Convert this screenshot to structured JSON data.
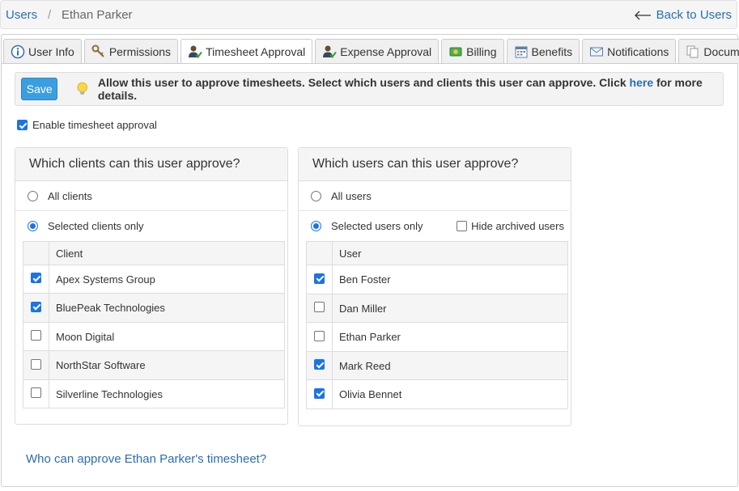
{
  "breadcrumb": {
    "root": "Users",
    "separator": "/",
    "current": "Ethan Parker",
    "back_label": "Back to Users"
  },
  "tabs": [
    {
      "label": "User Info",
      "icon": "info-icon",
      "active": false
    },
    {
      "label": "Permissions",
      "icon": "keys-icon",
      "active": false
    },
    {
      "label": "Timesheet Approval",
      "icon": "user-check-icon",
      "active": true
    },
    {
      "label": "Expense Approval",
      "icon": "user-check-icon",
      "active": false
    },
    {
      "label": "Billing",
      "icon": "money-icon",
      "active": false
    },
    {
      "label": "Benefits",
      "icon": "calendar-icon",
      "active": false
    },
    {
      "label": "Notifications",
      "icon": "envelope-icon",
      "active": false
    },
    {
      "label": "Documents",
      "icon": "documents-icon",
      "active": false
    }
  ],
  "notice": {
    "save_label": "Save",
    "text_before": "Allow this user to approve timesheets. Select which users and clients this user can approve. Click ",
    "link": "here",
    "text_after": " for more details."
  },
  "enable": {
    "label": "Enable timesheet approval",
    "checked": true
  },
  "clients_box": {
    "title": "Which clients can this user approve?",
    "opt_all": "All clients",
    "opt_selected": "Selected clients only",
    "selected_option": "selected",
    "column": "Client",
    "rows": [
      {
        "name": "Apex Systems Group",
        "checked": true
      },
      {
        "name": "BluePeak Technologies",
        "checked": true
      },
      {
        "name": "Moon Digital",
        "checked": false
      },
      {
        "name": "NorthStar Software",
        "checked": false
      },
      {
        "name": "Silverline Technologies",
        "checked": false
      }
    ]
  },
  "users_box": {
    "title": "Which users can this user approve?",
    "opt_all": "All users",
    "opt_selected": "Selected users only",
    "selected_option": "selected",
    "hide_archived": "Hide archived users",
    "hide_archived_checked": false,
    "column": "User",
    "rows": [
      {
        "name": "Ben Foster",
        "checked": true
      },
      {
        "name": "Dan Miller",
        "checked": false
      },
      {
        "name": "Ethan Parker",
        "checked": false
      },
      {
        "name": "Mark Reed",
        "checked": true
      },
      {
        "name": "Olivia Bennet",
        "checked": true
      }
    ]
  },
  "bottom_link": "Who can approve Ethan Parker's timesheet?",
  "colors": {
    "link": "#2a6fb0",
    "accent": "#3a9ee0",
    "check": "#1a73e8"
  }
}
